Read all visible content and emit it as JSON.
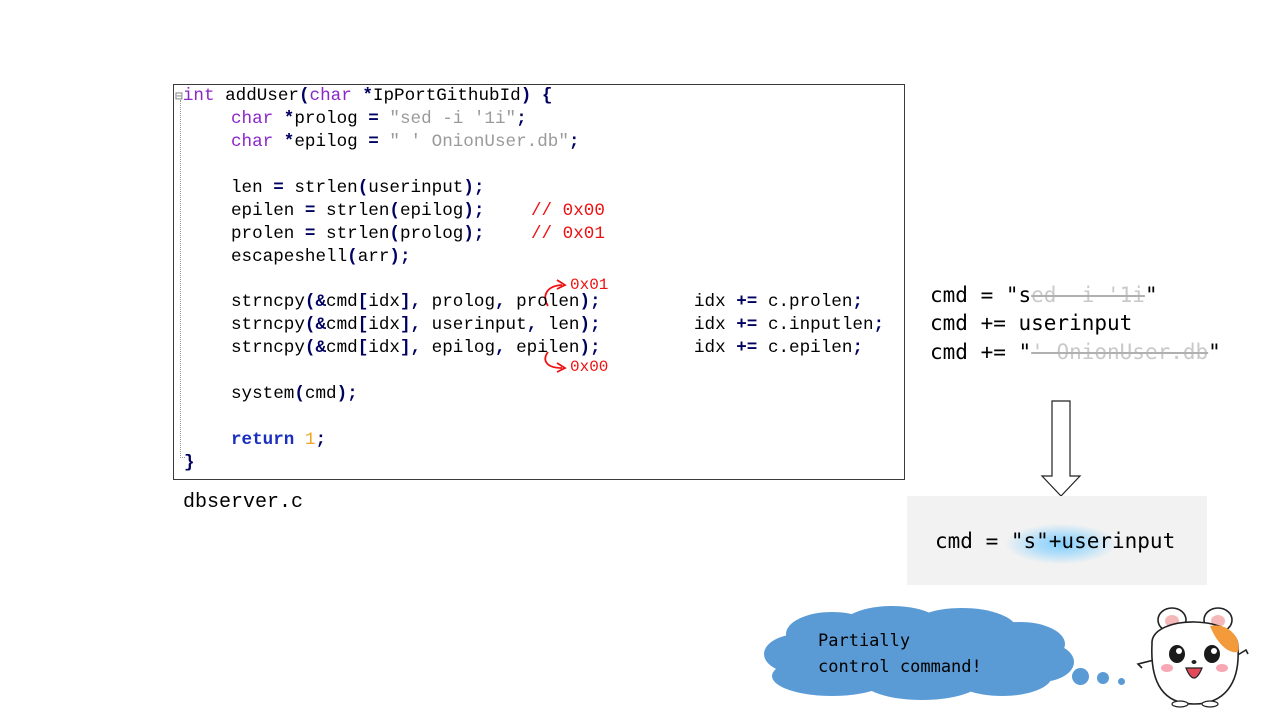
{
  "code": {
    "line_1": {
      "fold": "⊟",
      "type_int": "int",
      "name": "addUser",
      "paren_open": "(",
      "type_char": "char",
      "star": "*",
      "param": "IpPortGithubId",
      "paren_close": ")",
      "brace": "{"
    },
    "line_2": {
      "type": "char",
      "star": "*",
      "name": "prolog",
      "eq": "=",
      "str": "\"sed -i '1i\"",
      "semi": ";"
    },
    "line_3": {
      "type": "char",
      "star": "*",
      "name": "epilog",
      "eq": "=",
      "str": "\" ' OnionUser.db\"",
      "semi": ";"
    },
    "line_4": {
      "lhs": "len",
      "eq": "=",
      "fn": "strlen",
      "p1": "(",
      "arg": "userinput",
      "p2": ")",
      "semi": ";"
    },
    "line_5": {
      "lhs": "epilen",
      "eq": "=",
      "fn": "strlen",
      "p1": "(",
      "arg": "epilog",
      "p2": ")",
      "semi": ";"
    },
    "line_6": {
      "lhs": "prolen",
      "eq": "=",
      "fn": "strlen",
      "p1": "(",
      "arg": "prolog",
      "p2": ")",
      "semi": ";"
    },
    "line_7": {
      "fn": "escapeshell",
      "p1": "(",
      "arg": "arr",
      "p2": ")",
      "semi": ";"
    },
    "line_8": {
      "fn": "strncpy",
      "p1": "(",
      "amp": "&",
      "arr": "cmd",
      "b1": "[",
      "idx": "idx",
      "b2": "]",
      "comma1": ",",
      "arg2": " prolog",
      "comma2": ",",
      "arg3": " prolen",
      "p2": ")",
      "semi": ";",
      "rhs_var": "idx",
      "op": "+=",
      "rhs": "c.prolen",
      "semi2": ";"
    },
    "line_9": {
      "fn": "strncpy",
      "p1": "(",
      "amp": "&",
      "arr": "cmd",
      "b1": "[",
      "idx": "idx",
      "b2": "]",
      "comma1": ",",
      "arg2": " userinput",
      "comma2": ",",
      "arg3": " len",
      "p2": ")",
      "semi": ";",
      "rhs_var": "idx",
      "op": "+=",
      "rhs": "c.inputlen",
      "semi2": ";"
    },
    "line_10": {
      "fn": "strncpy",
      "p1": "(",
      "amp": "&",
      "arr": "cmd",
      "b1": "[",
      "idx": "idx",
      "b2": "]",
      "comma1": ",",
      "arg2": " epilog",
      "comma2": ",",
      "arg3": " epilen",
      "p2": ")",
      "semi": ";",
      "rhs_var": "idx",
      "op": "+=",
      "rhs": "c.epilen",
      "semi2": ";"
    },
    "line_11": {
      "fn": "system",
      "p1": "(",
      "arg": "cmd",
      "p2": ")",
      "semi": ";"
    },
    "line_12": {
      "kw": "return",
      "num": "1",
      "semi": ";"
    },
    "line_13": {
      "brace": "}"
    }
  },
  "annotations": {
    "epilen_comment": "// 0x00",
    "prolen_comment": "// 0x01",
    "prolen_value": "0x01",
    "epilen_value": "0x00"
  },
  "filename": "dbserver.c",
  "cmd_build": {
    "line_1_prefix": "cmd = \"s",
    "line_1_faded": "ed -i '1i",
    "line_1_suffix": "\"",
    "line_2": "cmd += userinput",
    "line_3_prefix": "cmd += \"",
    "line_3_faded": "' OnionUser.db",
    "line_3_suffix": "\""
  },
  "result": "cmd = \"s\"+userinput",
  "speech": {
    "line_1": "Partially",
    "line_2": "control command!"
  },
  "colors": {
    "keyword_type": "#8b27c9",
    "keyword": "#1a2fbf",
    "string": "#9a9a9a",
    "number": "#f1a224",
    "annotation_red": "#ee1111",
    "cloud_blue": "#5b9bd5",
    "glow": "#7dcdff",
    "result_bg": "#f2f2f2"
  },
  "icons": {
    "down_arrow": "down-arrow-icon",
    "curved_arrow": "curved-arrow-icon",
    "mascot": "hamster-mascot"
  }
}
